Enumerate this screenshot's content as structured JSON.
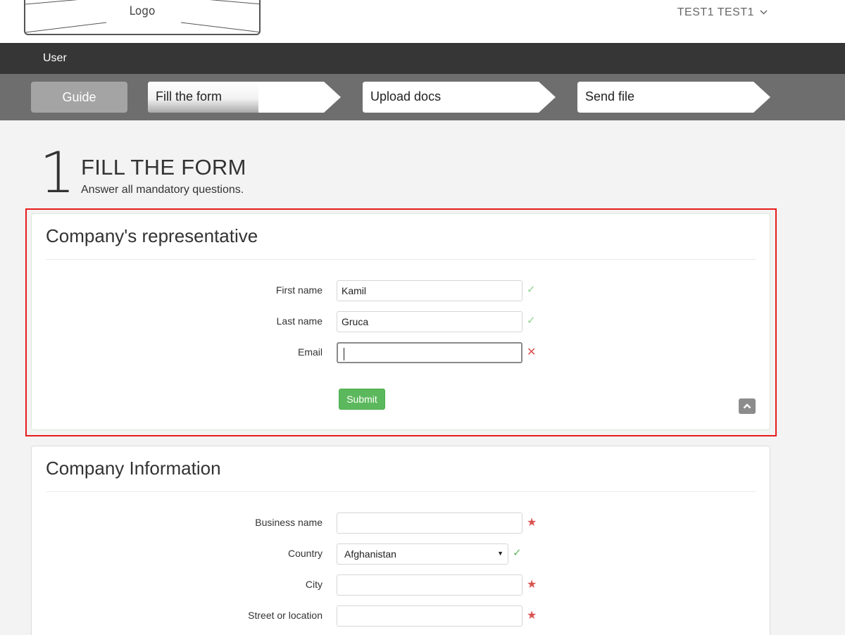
{
  "header": {
    "logo_text": "Logo",
    "user_name": "TEST1 TEST1"
  },
  "nav": {
    "item": "User"
  },
  "steps": {
    "guide_label": "Guide",
    "items": [
      {
        "label": "Fill the form",
        "active": true
      },
      {
        "label": "Upload docs",
        "active": false
      },
      {
        "label": "Send file",
        "active": false
      }
    ]
  },
  "page": {
    "step_number": "1",
    "title": "FILL THE FORM",
    "subtitle": "Answer all mandatory questions."
  },
  "representative": {
    "title": "Company's representative",
    "fields": [
      {
        "label": "First name",
        "value": "Kamil",
        "status": "✓"
      },
      {
        "label": "Last name",
        "value": "Gruca",
        "status": "✓"
      },
      {
        "label": "Email",
        "value": "",
        "status": "✕"
      }
    ],
    "submit_label": "Submit"
  },
  "company": {
    "title": "Company Information",
    "fields": [
      {
        "label": "Business name",
        "value": "",
        "status": "★"
      },
      {
        "label": "Country",
        "value": "Afghanistan",
        "status": "✓"
      },
      {
        "label": "City",
        "value": "",
        "status": "★"
      },
      {
        "label": "Street or location",
        "value": "",
        "status": "★"
      }
    ]
  },
  "colors": {
    "accent_green": "#5cb85c",
    "error_red": "#d9534f",
    "highlight_red": "#e81c1c",
    "nav_dark": "#363636",
    "steps_gray": "#6e6e6e"
  },
  "icons": {
    "user_menu": "chevron-down-icon",
    "collapse": "chevron-up-icon",
    "valid": "check-icon",
    "invalid": "close-icon",
    "required": "star-icon"
  }
}
